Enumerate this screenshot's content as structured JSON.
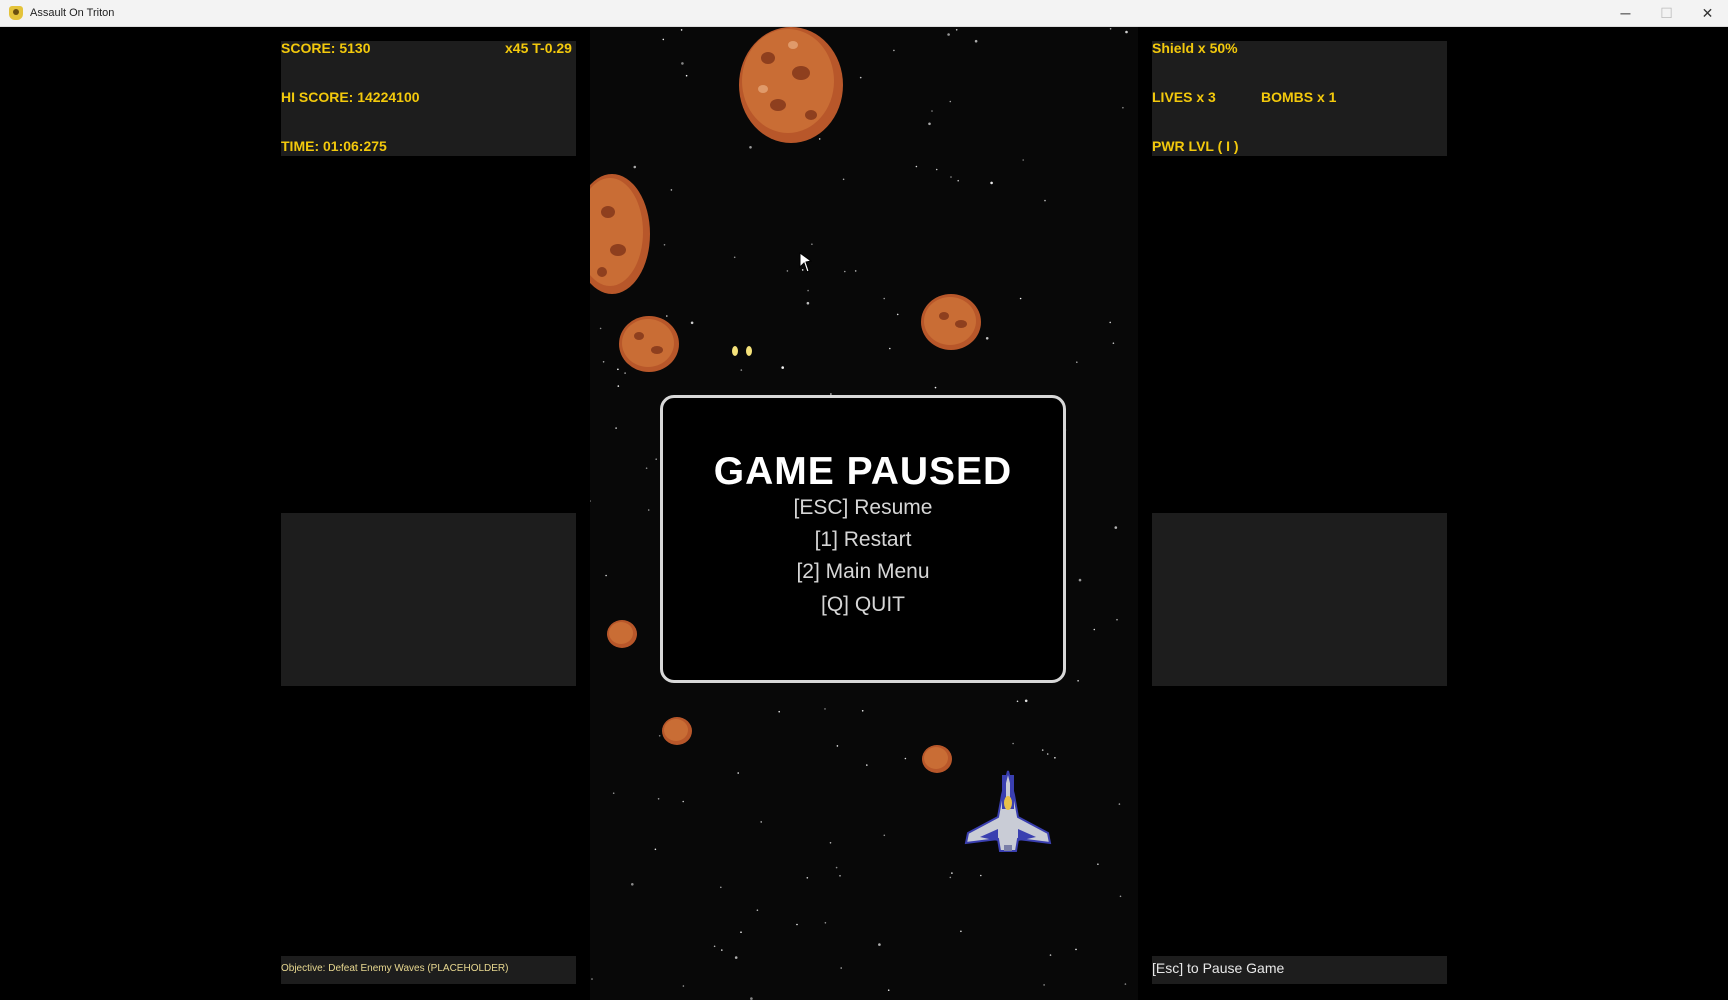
{
  "window": {
    "title": "Assault On Triton",
    "minimize_glyph": "─",
    "maximize_glyph": "☐",
    "close_glyph": "✕"
  },
  "hud": {
    "score": "SCORE: 5130",
    "multiplier": "x45 T-0.29",
    "hi_score": "HI SCORE: 14224100",
    "time": "TIME: 01:06:275",
    "shield": "Shield x 50%",
    "lives": "LIVES x 3",
    "bombs": "BOMBS x 1",
    "power_level": "PWR LVL ( I )",
    "objective": "Objective: Defeat Enemy Waves (PLACEHOLDER)",
    "pause_hint": "[Esc] to Pause Game"
  },
  "pause_menu": {
    "title": "GAME PAUSED",
    "options": [
      "[ESC] Resume",
      "[1] Restart",
      "[2] Main Menu",
      "[Q] QUIT"
    ]
  },
  "colors": {
    "hud_text": "#f3c90c",
    "panel_bg": "#1d1d1d",
    "asteroid": "#c0642a",
    "ship_body": "#c9ccd6",
    "ship_accent": "#3a3fb0"
  },
  "icons": {
    "app": "game-icon",
    "ship": "player-ship-icon",
    "asteroid": "asteroid-icon",
    "cursor": "mouse-cursor-icon"
  }
}
